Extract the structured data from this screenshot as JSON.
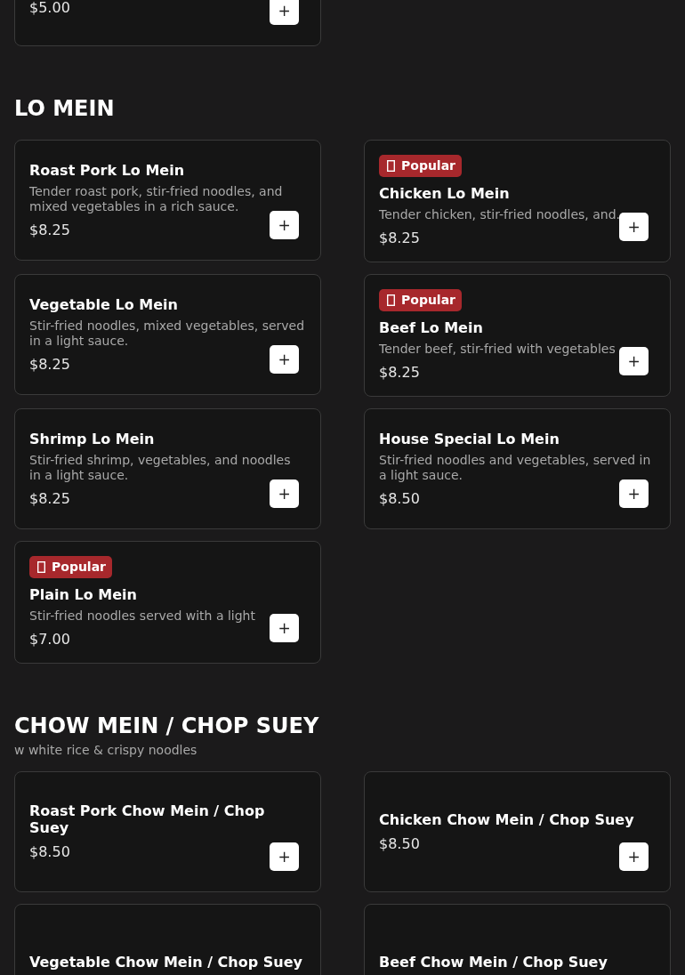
{
  "sections": [
    {
      "items": [
        {
          "price": "$5.00",
          "button": "+"
        }
      ]
    },
    {
      "title": "LO MEIN",
      "items": [
        {
          "name": "Roast Pork Lo Mein",
          "description": "Tender roast pork, stir-fried noodles, and mixed vegetables in a rich sauce.",
          "price": "$8.25",
          "button": "+"
        },
        {
          "badge": "Popular",
          "name": "Chicken Lo Mein",
          "description": "Tender chicken, stir-fried noodles, and.",
          "price": "$8.25",
          "button": "+"
        },
        {
          "name": "Vegetable Lo Mein",
          "description": "Stir-fried noodles, mixed vegetables, served in a light sauce.",
          "price": "$8.25",
          "button": "+"
        },
        {
          "badge": "Popular",
          "name": "Beef Lo Mein",
          "description": "Tender beef, stir-fried with vegetables",
          "price": "$8.25",
          "button": "+"
        },
        {
          "name": "Shrimp Lo Mein",
          "description": "Stir-fried shrimp, vegetables, and noodles in a light sauce.",
          "price": "$8.25",
          "button": "+"
        },
        {
          "name": "House Special Lo Mein",
          "description": "Stir-fried noodles and vegetables, served in a light sauce.",
          "price": "$8.50",
          "button": "+"
        },
        {
          "badge": "Popular",
          "name": "Plain Lo Mein",
          "description": "Stir-fried noodles served with a light",
          "price": "$7.00",
          "button": "+"
        }
      ]
    },
    {
      "title": "CHOW MEIN / CHOP SUEY",
      "subtitle": "w white rice & crispy noodles",
      "items": [
        {
          "name": "Roast Pork Chow Mein / Chop Suey",
          "price": "$8.50",
          "button": "+"
        },
        {
          "name": "Chicken Chow Mein / Chop Suey",
          "price": "$8.50",
          "button": "+"
        },
        {
          "name": "Vegetable Chow Mein / Chop Suey"
        },
        {
          "name": "Beef Chow Mein / Chop Suey"
        }
      ]
    }
  ]
}
